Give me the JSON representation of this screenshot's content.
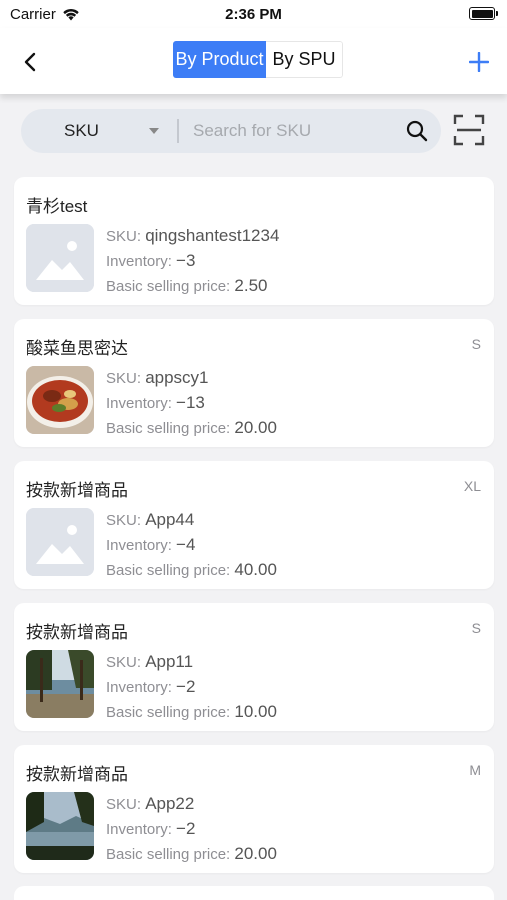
{
  "status_bar": {
    "carrier": "Carrier",
    "time": "2:36 PM"
  },
  "nav": {
    "segments": [
      "By Product",
      "By SPU"
    ],
    "active_segment": "By Product",
    "accent_color": "#3d7df6"
  },
  "search": {
    "type_label": "SKU",
    "placeholder": "Search for SKU",
    "value": ""
  },
  "labels": {
    "sku": "SKU:",
    "inventory": "Inventory:",
    "price": "Basic selling price:"
  },
  "products": [
    {
      "name": "青杉test",
      "spec": "",
      "sku": "qingshantest1234",
      "inventory": "−3",
      "price": "2.50",
      "image": "placeholder-image-icon"
    },
    {
      "name": "酸菜鱼思密达",
      "spec": "S",
      "sku": "appscy1",
      "inventory": "−13",
      "price": "20.00",
      "image": "food-dish-photo"
    },
    {
      "name": "按款新增商品",
      "spec": "XL",
      "sku": "App44",
      "inventory": "−4",
      "price": "40.00",
      "image": "placeholder-image-icon"
    },
    {
      "name": "按款新增商品",
      "spec": "S",
      "sku": "App11",
      "inventory": "−2",
      "price": "10.00",
      "image": "lake-trees-photo"
    },
    {
      "name": "按款新增商品",
      "spec": "M",
      "sku": "App22",
      "inventory": "−2",
      "price": "20.00",
      "image": "lake-mountain-photo"
    }
  ]
}
